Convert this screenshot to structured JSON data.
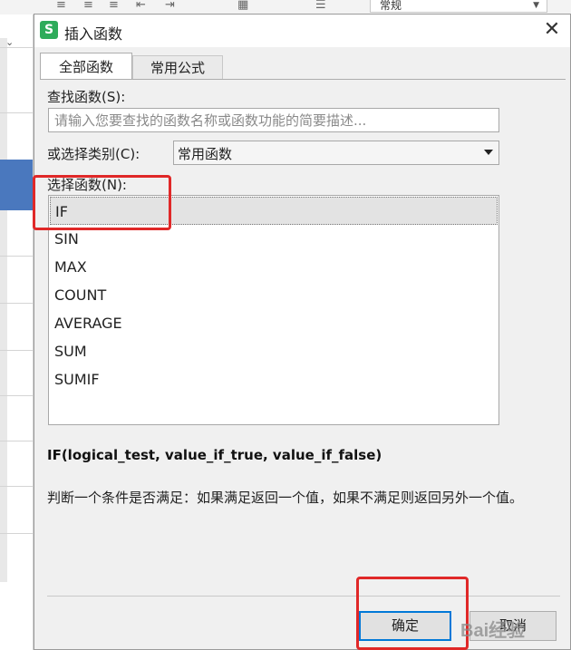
{
  "background": {
    "format_select": "常规"
  },
  "dialog": {
    "title": "插入函数",
    "logo_letter": "S",
    "close_glyph": "✕",
    "tabs": [
      {
        "label": "全部函数",
        "active": true
      },
      {
        "label": "常用公式",
        "active": false
      }
    ],
    "search": {
      "label": "查找函数(S):",
      "placeholder": "请输入您要查找的函数名称或函数功能的简要描述..."
    },
    "category": {
      "label": "或选择类别(C):",
      "value": "常用函数"
    },
    "functions": {
      "label": "选择函数(N):",
      "items": [
        "IF",
        "SIN",
        "MAX",
        "COUNT",
        "AVERAGE",
        "SUM",
        "SUMIF"
      ],
      "selected": "IF"
    },
    "syntax": "IF(logical_test, value_if_true, value_if_false)",
    "description": "判断一个条件是否满足：如果满足返回一个值，如果不满足则返回另外一个值。",
    "buttons": {
      "ok": "确定",
      "cancel": "取消"
    }
  },
  "colors": {
    "highlight": "#e02828",
    "logo": "#2eab5a",
    "selection_row": "#4a78be"
  },
  "watermark": "Bai经验"
}
